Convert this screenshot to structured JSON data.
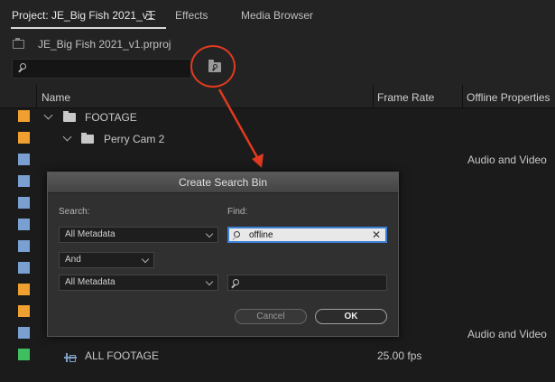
{
  "tabs": [
    {
      "label": "Project: JE_Big Fish 2021_v1"
    },
    {
      "label": "Effects"
    },
    {
      "label": "Media Browser"
    }
  ],
  "project": {
    "file_name": "JE_Big Fish 2021_v1.prproj"
  },
  "search": {
    "placeholder": ""
  },
  "columns": {
    "name": "Name",
    "frame_rate": "Frame Rate",
    "offline": "Offline Properties"
  },
  "rows": {
    "footage": {
      "name": "FOOTAGE",
      "color": "#f0a030"
    },
    "perry_cam": {
      "name": "Perry Cam 2",
      "color": "#f0a030"
    },
    "clip1": {
      "frame_rate": "",
      "offline": "Audio and Video",
      "color": "#7aa0d2"
    },
    "clip_last": {
      "offline": "Audio and Video",
      "color": "#7aa0d2"
    },
    "all_footage": {
      "name": "ALL FOOTAGE",
      "frame_rate": "25.00 fps",
      "color": "#3fbf5f"
    }
  },
  "colors": {
    "accent": "#e23a1f",
    "label_blue": "#7aa0d2",
    "label_orange": "#f0a030",
    "label_green": "#3fbf5f"
  },
  "dialog": {
    "title": "Create Search Bin",
    "search_label": "Search:",
    "find_label": "Find:",
    "search1": "All Metadata",
    "find1": "offline",
    "operator": "And",
    "search2": "All Metadata",
    "find2": "",
    "cancel": "Cancel",
    "ok": "OK"
  }
}
